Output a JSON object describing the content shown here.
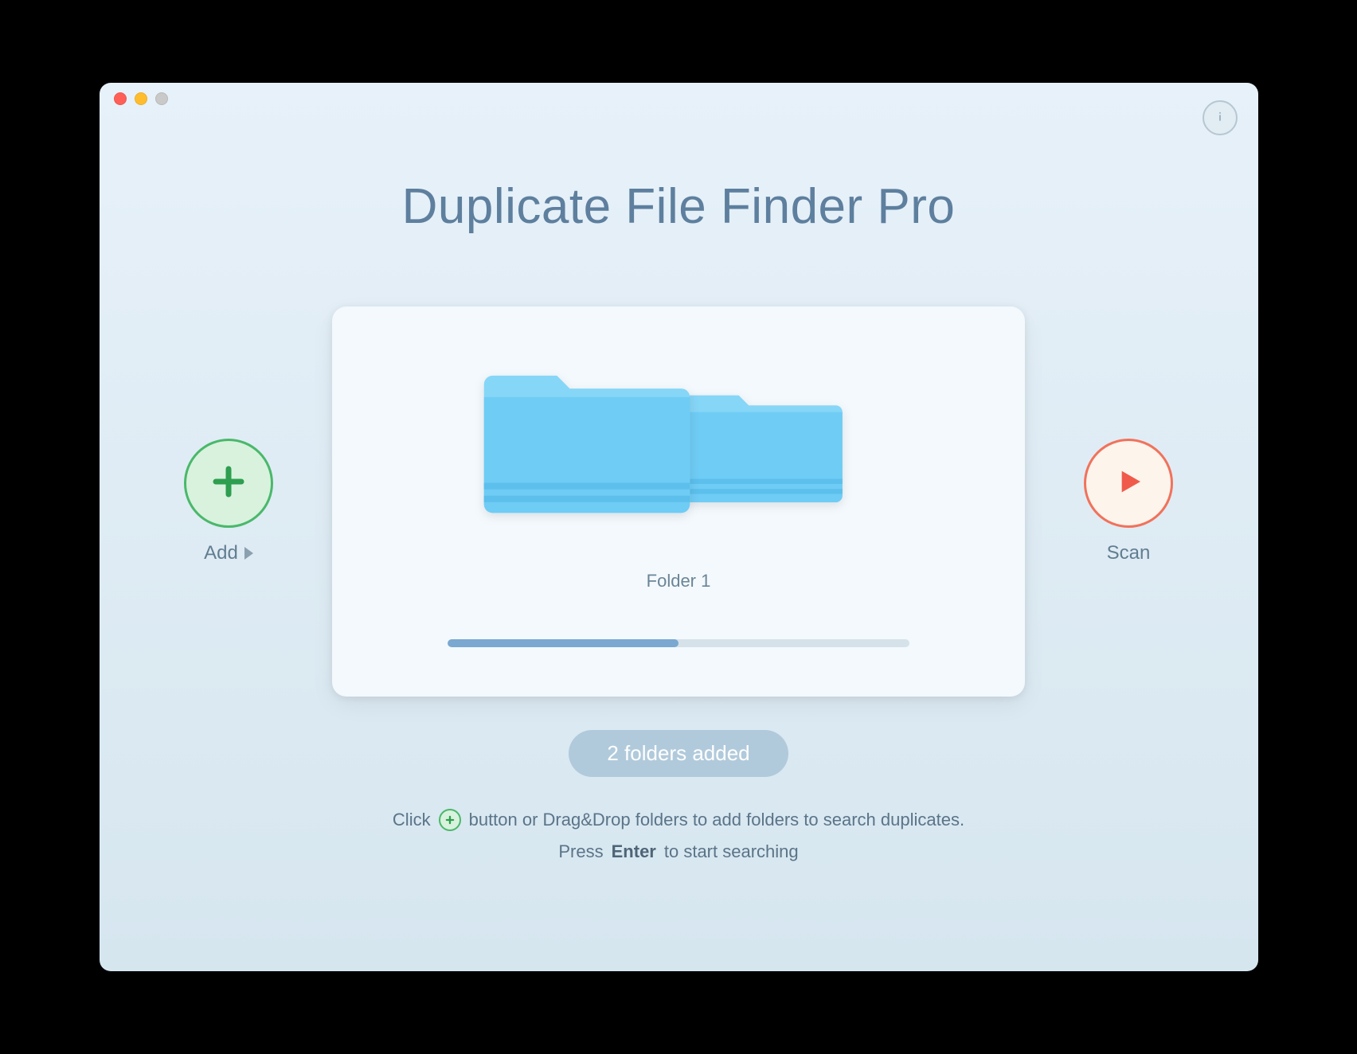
{
  "app": {
    "title": "Duplicate File Finder Pro"
  },
  "buttons": {
    "add_label": "Add",
    "scan_label": "Scan"
  },
  "card": {
    "folder_label": "Folder 1",
    "progress_percent": 50
  },
  "status": {
    "pill_text": "2 folders added"
  },
  "hints": {
    "line1_pre": "Click",
    "line1_post": "button or Drag&Drop folders to add folders to search duplicates.",
    "line2_pre": "Press",
    "line2_bold": "Enter",
    "line2_post": "to start searching"
  },
  "colors": {
    "title": "#5e7f9e",
    "add_ring": "#4ab86a",
    "scan_ring": "#f1725b",
    "folder": "#6fccf5",
    "progress_fill": "#7aa8d0"
  }
}
